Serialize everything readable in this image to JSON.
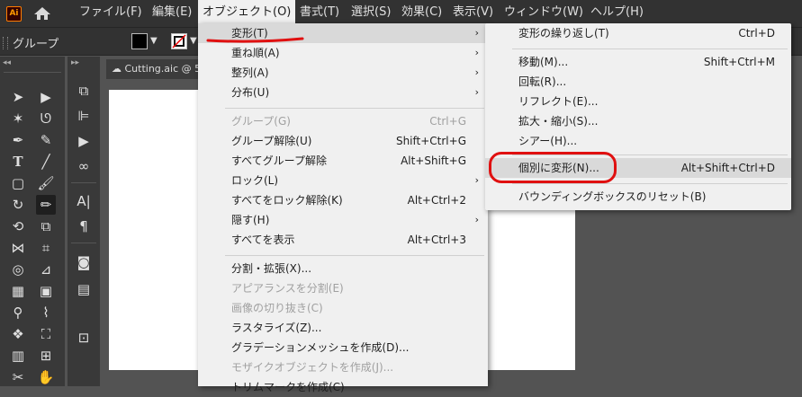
{
  "app": {
    "logo": "Ai",
    "home_icon": "home-icon"
  },
  "menubar": {
    "items": [
      {
        "label": "ファイル(F)"
      },
      {
        "label": "編集(E)"
      },
      {
        "label": "オブジェクト(O)",
        "active": true
      },
      {
        "label": "書式(T)"
      },
      {
        "label": "選択(S)"
      },
      {
        "label": "効果(C)"
      },
      {
        "label": "表示(V)"
      },
      {
        "label": "ウィンドウ(W)"
      },
      {
        "label": "ヘルプ(H)"
      }
    ]
  },
  "control_bar": {
    "object_type": "グループ"
  },
  "document": {
    "tab_title": "Cutting.aic @ 5"
  },
  "object_menu": {
    "items": [
      {
        "label": "変形(T)",
        "submenu": true,
        "highlighted": true
      },
      {
        "label": "重ね順(A)",
        "submenu": true
      },
      {
        "label": "整列(A)",
        "submenu": true
      },
      {
        "label": "分布(U)",
        "submenu": true
      },
      {
        "label": "グループ(G)",
        "shortcut": "Ctrl+G",
        "disabled": true
      },
      {
        "label": "グループ解除(U)",
        "shortcut": "Shift+Ctrl+G"
      },
      {
        "label": "すべてグループ解除",
        "shortcut": "Alt+Shift+G"
      },
      {
        "label": "ロック(L)",
        "submenu": true
      },
      {
        "label": "すべてをロック解除(K)",
        "shortcut": "Alt+Ctrl+2"
      },
      {
        "label": "隠す(H)",
        "submenu": true
      },
      {
        "label": "すべてを表示",
        "shortcut": "Alt+Ctrl+3"
      },
      {
        "label": "分割・拡張(X)..."
      },
      {
        "label": "アピアランスを分割(E)",
        "disabled": true
      },
      {
        "label": "画像の切り抜き(C)",
        "disabled": true
      },
      {
        "label": "ラスタライズ(Z)..."
      },
      {
        "label": "グラデーションメッシュを作成(D)..."
      },
      {
        "label": "モザイクオブジェクトを作成(J)...",
        "disabled": true
      },
      {
        "label": "トリムマークを作成(C)"
      }
    ]
  },
  "transform_submenu": {
    "items": [
      {
        "label": "変形の繰り返し(T)",
        "shortcut": "Ctrl+D"
      },
      {
        "label": "移動(M)...",
        "shortcut": "Shift+Ctrl+M"
      },
      {
        "label": "回転(R)..."
      },
      {
        "label": "リフレクト(E)..."
      },
      {
        "label": "拡大・縮小(S)..."
      },
      {
        "label": "シアー(H)..."
      },
      {
        "label": "個別に変形(N)...",
        "shortcut": "Alt+Shift+Ctrl+D",
        "highlighted": true
      },
      {
        "label": "バウンディングボックスのリセット(B)"
      }
    ]
  },
  "colors": {
    "annotation_red": "#e01010",
    "menu_bg": "#f0f0f0",
    "app_bg": "#535353"
  }
}
